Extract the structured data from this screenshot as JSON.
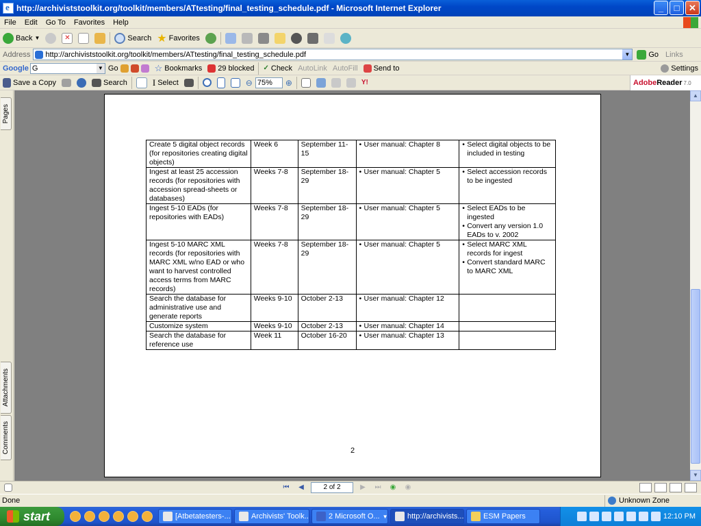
{
  "window": {
    "title": "http://archiviststoolkit.org/toolkit/members/ATtesting/final_testing_schedule.pdf - Microsoft Internet Explorer",
    "minimize": "_",
    "maximize": "□",
    "close": "✕"
  },
  "menu": [
    "File",
    "Edit",
    "Go To",
    "Favorites",
    "Help"
  ],
  "std_toolbar": {
    "back": "Back",
    "search": "Search",
    "favorites": "Favorites"
  },
  "address": {
    "label": "Address",
    "url": "http://archiviststoolkit.org/toolkit/members/ATtesting/final_testing_schedule.pdf",
    "go": "Go",
    "links": "Links"
  },
  "google_toolbar": {
    "logo": "Google",
    "search_value": "G",
    "go": "Go",
    "bookmarks": "Bookmarks",
    "blocked": "29 blocked",
    "check": "Check",
    "autolink": "AutoLink",
    "autofill": "AutoFill",
    "send_to": "Send to",
    "settings": "Settings"
  },
  "acrobat_toolbar": {
    "save_copy": "Save a Copy",
    "search": "Search",
    "select": "Select",
    "zoom": "75%",
    "brand_a": "Adobe",
    "brand_b": "Reader",
    "brand_ver": "7.0"
  },
  "nav_tabs": {
    "pages": "Pages",
    "attachments": "Attachments",
    "comments": "Comments"
  },
  "document": {
    "rows": [
      {
        "task": "Create 5 digital object records (for repositories creating digital objects)",
        "week": "Week 6",
        "dates": "September 11-15",
        "resources": [
          "User manual: Chapter 8"
        ],
        "actions": [
          "Select digital objects to be included in testing"
        ]
      },
      {
        "task": "Ingest at least 25 accession records (for repositories with accession spread-sheets or databases)",
        "week": "Weeks 7-8",
        "dates": "September 18-29",
        "resources": [
          "User manual: Chapter 5"
        ],
        "actions": [
          "Select accession records to be ingested"
        ]
      },
      {
        "task": "Ingest 5-10 EADs (for repositories with EADs)",
        "week": "Weeks 7-8",
        "dates": "September 18-29",
        "resources": [
          "User manual: Chapter 5"
        ],
        "actions": [
          "Select EADs to be ingested",
          "Convert any version 1.0 EADs to v. 2002"
        ]
      },
      {
        "task": "Ingest 5-10 MARC XML records (for repositories with MARC XML w/no EAD or who want to harvest controlled access terms from MARC records)",
        "week": "Weeks 7-8",
        "dates": "September 18-29",
        "resources": [
          "User manual: Chapter 5"
        ],
        "actions": [
          "Select MARC XML records for ingest",
          "Convert standard MARC to MARC XML"
        ]
      },
      {
        "task": "Search the database for administrative use and generate reports",
        "week": "Weeks 9-10",
        "dates": "October 2-13",
        "resources": [
          "User manual: Chapter 12"
        ],
        "actions": []
      },
      {
        "task": "Customize system",
        "week": "Weeks 9-10",
        "dates": "October 2-13",
        "resources": [
          "User manual: Chapter 14"
        ],
        "actions": []
      },
      {
        "task": "Search the database for reference use",
        "week": "Week 11",
        "dates": "October 16-20",
        "resources": [
          "User manual: Chapter 13"
        ],
        "actions": []
      }
    ],
    "page_number": "2"
  },
  "page_nav": {
    "current": "2 of 2"
  },
  "status": {
    "text": "Done",
    "zone": "Unknown Zone"
  },
  "taskbar": {
    "start": "start",
    "buttons": [
      "[Atbetatesters-...",
      "Archivists' Toolk...",
      "2 Microsoft O...",
      "http://archivists...",
      "ESM Papers"
    ],
    "clock": "12:10 PM"
  }
}
